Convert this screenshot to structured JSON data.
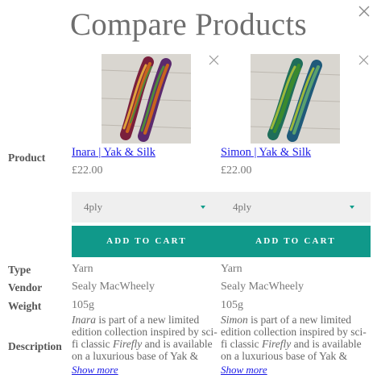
{
  "modal": {
    "title": "Compare Products",
    "close_icon": "close-icon"
  },
  "row_labels": {
    "product": "Product",
    "type": "Type",
    "vendor": "Vendor",
    "weight": "Weight",
    "description": "Description"
  },
  "products": [
    {
      "name": "Inara | Yak & Silk",
      "price": "£22.00",
      "variant": "4ply",
      "add_to_cart": "ADD TO CART",
      "type": "Yarn",
      "vendor": "Sealy MacWheely",
      "weight": "105g",
      "desc_name": "Inara",
      "desc_part1": " is part of a new limited edition collection inspired by sci-fi classic ",
      "desc_show": "Firefly",
      "desc_part2": " and is available on a luxurious base of Yak &",
      "show_more": "Show more",
      "image_colors": [
        "#7a1f3c",
        "#c8641e",
        "#e0a23a",
        "#4f8a3a",
        "#5b2a6e"
      ]
    },
    {
      "name": "Simon | Yak & Silk",
      "price": "£22.00",
      "variant": "4ply",
      "add_to_cart": "ADD TO CART",
      "type": "Yarn",
      "vendor": "Sealy MacWheely",
      "weight": "105g",
      "desc_name": "Simon",
      "desc_part1": " is part of a new limited edition collection inspired by sci-fi classic ",
      "desc_show": "Firefly",
      "desc_part2": " and is available on a luxurious base of Yak &",
      "show_more": "Show more",
      "image_colors": [
        "#1f6e5a",
        "#3a8a2e",
        "#9cb83a",
        "#1f5a7a",
        "#5aa06e"
      ]
    }
  ],
  "colors": {
    "accent": "#10998a",
    "link": "#1a1ae6",
    "select_bg": "#efefef"
  }
}
